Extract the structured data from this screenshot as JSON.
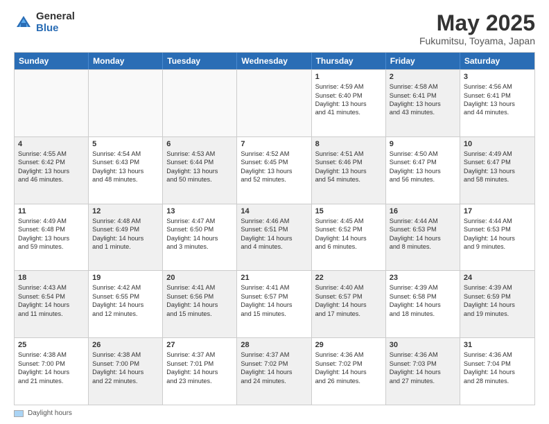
{
  "logo": {
    "general": "General",
    "blue": "Blue"
  },
  "title": "May 2025",
  "subtitle": "Fukumitsu, Toyama, Japan",
  "weekdays": [
    "Sunday",
    "Monday",
    "Tuesday",
    "Wednesday",
    "Thursday",
    "Friday",
    "Saturday"
  ],
  "footer": {
    "legend_label": "Daylight hours"
  },
  "rows": [
    [
      {
        "day": "",
        "lines": [],
        "empty": true
      },
      {
        "day": "",
        "lines": [],
        "empty": true
      },
      {
        "day": "",
        "lines": [],
        "empty": true
      },
      {
        "day": "",
        "lines": [],
        "empty": true
      },
      {
        "day": "1",
        "lines": [
          "Sunrise: 4:59 AM",
          "Sunset: 6:40 PM",
          "Daylight: 13 hours",
          "and 41 minutes."
        ],
        "empty": false
      },
      {
        "day": "2",
        "lines": [
          "Sunrise: 4:58 AM",
          "Sunset: 6:41 PM",
          "Daylight: 13 hours",
          "and 43 minutes."
        ],
        "empty": false,
        "shaded": true
      },
      {
        "day": "3",
        "lines": [
          "Sunrise: 4:56 AM",
          "Sunset: 6:41 PM",
          "Daylight: 13 hours",
          "and 44 minutes."
        ],
        "empty": false
      }
    ],
    [
      {
        "day": "4",
        "lines": [
          "Sunrise: 4:55 AM",
          "Sunset: 6:42 PM",
          "Daylight: 13 hours",
          "and 46 minutes."
        ],
        "empty": false,
        "shaded": true
      },
      {
        "day": "5",
        "lines": [
          "Sunrise: 4:54 AM",
          "Sunset: 6:43 PM",
          "Daylight: 13 hours",
          "and 48 minutes."
        ],
        "empty": false
      },
      {
        "day": "6",
        "lines": [
          "Sunrise: 4:53 AM",
          "Sunset: 6:44 PM",
          "Daylight: 13 hours",
          "and 50 minutes."
        ],
        "empty": false,
        "shaded": true
      },
      {
        "day": "7",
        "lines": [
          "Sunrise: 4:52 AM",
          "Sunset: 6:45 PM",
          "Daylight: 13 hours",
          "and 52 minutes."
        ],
        "empty": false
      },
      {
        "day": "8",
        "lines": [
          "Sunrise: 4:51 AM",
          "Sunset: 6:46 PM",
          "Daylight: 13 hours",
          "and 54 minutes."
        ],
        "empty": false,
        "shaded": true
      },
      {
        "day": "9",
        "lines": [
          "Sunrise: 4:50 AM",
          "Sunset: 6:47 PM",
          "Daylight: 13 hours",
          "and 56 minutes."
        ],
        "empty": false
      },
      {
        "day": "10",
        "lines": [
          "Sunrise: 4:49 AM",
          "Sunset: 6:47 PM",
          "Daylight: 13 hours",
          "and 58 minutes."
        ],
        "empty": false,
        "shaded": true
      }
    ],
    [
      {
        "day": "11",
        "lines": [
          "Sunrise: 4:49 AM",
          "Sunset: 6:48 PM",
          "Daylight: 13 hours",
          "and 59 minutes."
        ],
        "empty": false
      },
      {
        "day": "12",
        "lines": [
          "Sunrise: 4:48 AM",
          "Sunset: 6:49 PM",
          "Daylight: 14 hours",
          "and 1 minute."
        ],
        "empty": false,
        "shaded": true
      },
      {
        "day": "13",
        "lines": [
          "Sunrise: 4:47 AM",
          "Sunset: 6:50 PM",
          "Daylight: 14 hours",
          "and 3 minutes."
        ],
        "empty": false
      },
      {
        "day": "14",
        "lines": [
          "Sunrise: 4:46 AM",
          "Sunset: 6:51 PM",
          "Daylight: 14 hours",
          "and 4 minutes."
        ],
        "empty": false,
        "shaded": true
      },
      {
        "day": "15",
        "lines": [
          "Sunrise: 4:45 AM",
          "Sunset: 6:52 PM",
          "Daylight: 14 hours",
          "and 6 minutes."
        ],
        "empty": false
      },
      {
        "day": "16",
        "lines": [
          "Sunrise: 4:44 AM",
          "Sunset: 6:53 PM",
          "Daylight: 14 hours",
          "and 8 minutes."
        ],
        "empty": false,
        "shaded": true
      },
      {
        "day": "17",
        "lines": [
          "Sunrise: 4:44 AM",
          "Sunset: 6:53 PM",
          "Daylight: 14 hours",
          "and 9 minutes."
        ],
        "empty": false
      }
    ],
    [
      {
        "day": "18",
        "lines": [
          "Sunrise: 4:43 AM",
          "Sunset: 6:54 PM",
          "Daylight: 14 hours",
          "and 11 minutes."
        ],
        "empty": false,
        "shaded": true
      },
      {
        "day": "19",
        "lines": [
          "Sunrise: 4:42 AM",
          "Sunset: 6:55 PM",
          "Daylight: 14 hours",
          "and 12 minutes."
        ],
        "empty": false
      },
      {
        "day": "20",
        "lines": [
          "Sunrise: 4:41 AM",
          "Sunset: 6:56 PM",
          "Daylight: 14 hours",
          "and 15 minutes."
        ],
        "empty": false,
        "shaded": true
      },
      {
        "day": "21",
        "lines": [
          "Sunrise: 4:41 AM",
          "Sunset: 6:57 PM",
          "Daylight: 14 hours",
          "and 15 minutes."
        ],
        "empty": false
      },
      {
        "day": "22",
        "lines": [
          "Sunrise: 4:40 AM",
          "Sunset: 6:57 PM",
          "Daylight: 14 hours",
          "and 17 minutes."
        ],
        "empty": false,
        "shaded": true
      },
      {
        "day": "23",
        "lines": [
          "Sunrise: 4:39 AM",
          "Sunset: 6:58 PM",
          "Daylight: 14 hours",
          "and 18 minutes."
        ],
        "empty": false
      },
      {
        "day": "24",
        "lines": [
          "Sunrise: 4:39 AM",
          "Sunset: 6:59 PM",
          "Daylight: 14 hours",
          "and 19 minutes."
        ],
        "empty": false,
        "shaded": true
      }
    ],
    [
      {
        "day": "25",
        "lines": [
          "Sunrise: 4:38 AM",
          "Sunset: 7:00 PM",
          "Daylight: 14 hours",
          "and 21 minutes."
        ],
        "empty": false
      },
      {
        "day": "26",
        "lines": [
          "Sunrise: 4:38 AM",
          "Sunset: 7:00 PM",
          "Daylight: 14 hours",
          "and 22 minutes."
        ],
        "empty": false,
        "shaded": true
      },
      {
        "day": "27",
        "lines": [
          "Sunrise: 4:37 AM",
          "Sunset: 7:01 PM",
          "Daylight: 14 hours",
          "and 23 minutes."
        ],
        "empty": false
      },
      {
        "day": "28",
        "lines": [
          "Sunrise: 4:37 AM",
          "Sunset: 7:02 PM",
          "Daylight: 14 hours",
          "and 24 minutes."
        ],
        "empty": false,
        "shaded": true
      },
      {
        "day": "29",
        "lines": [
          "Sunrise: 4:36 AM",
          "Sunset: 7:02 PM",
          "Daylight: 14 hours",
          "and 26 minutes."
        ],
        "empty": false
      },
      {
        "day": "30",
        "lines": [
          "Sunrise: 4:36 AM",
          "Sunset: 7:03 PM",
          "Daylight: 14 hours",
          "and 27 minutes."
        ],
        "empty": false,
        "shaded": true
      },
      {
        "day": "31",
        "lines": [
          "Sunrise: 4:36 AM",
          "Sunset: 7:04 PM",
          "Daylight: 14 hours",
          "and 28 minutes."
        ],
        "empty": false
      }
    ]
  ]
}
